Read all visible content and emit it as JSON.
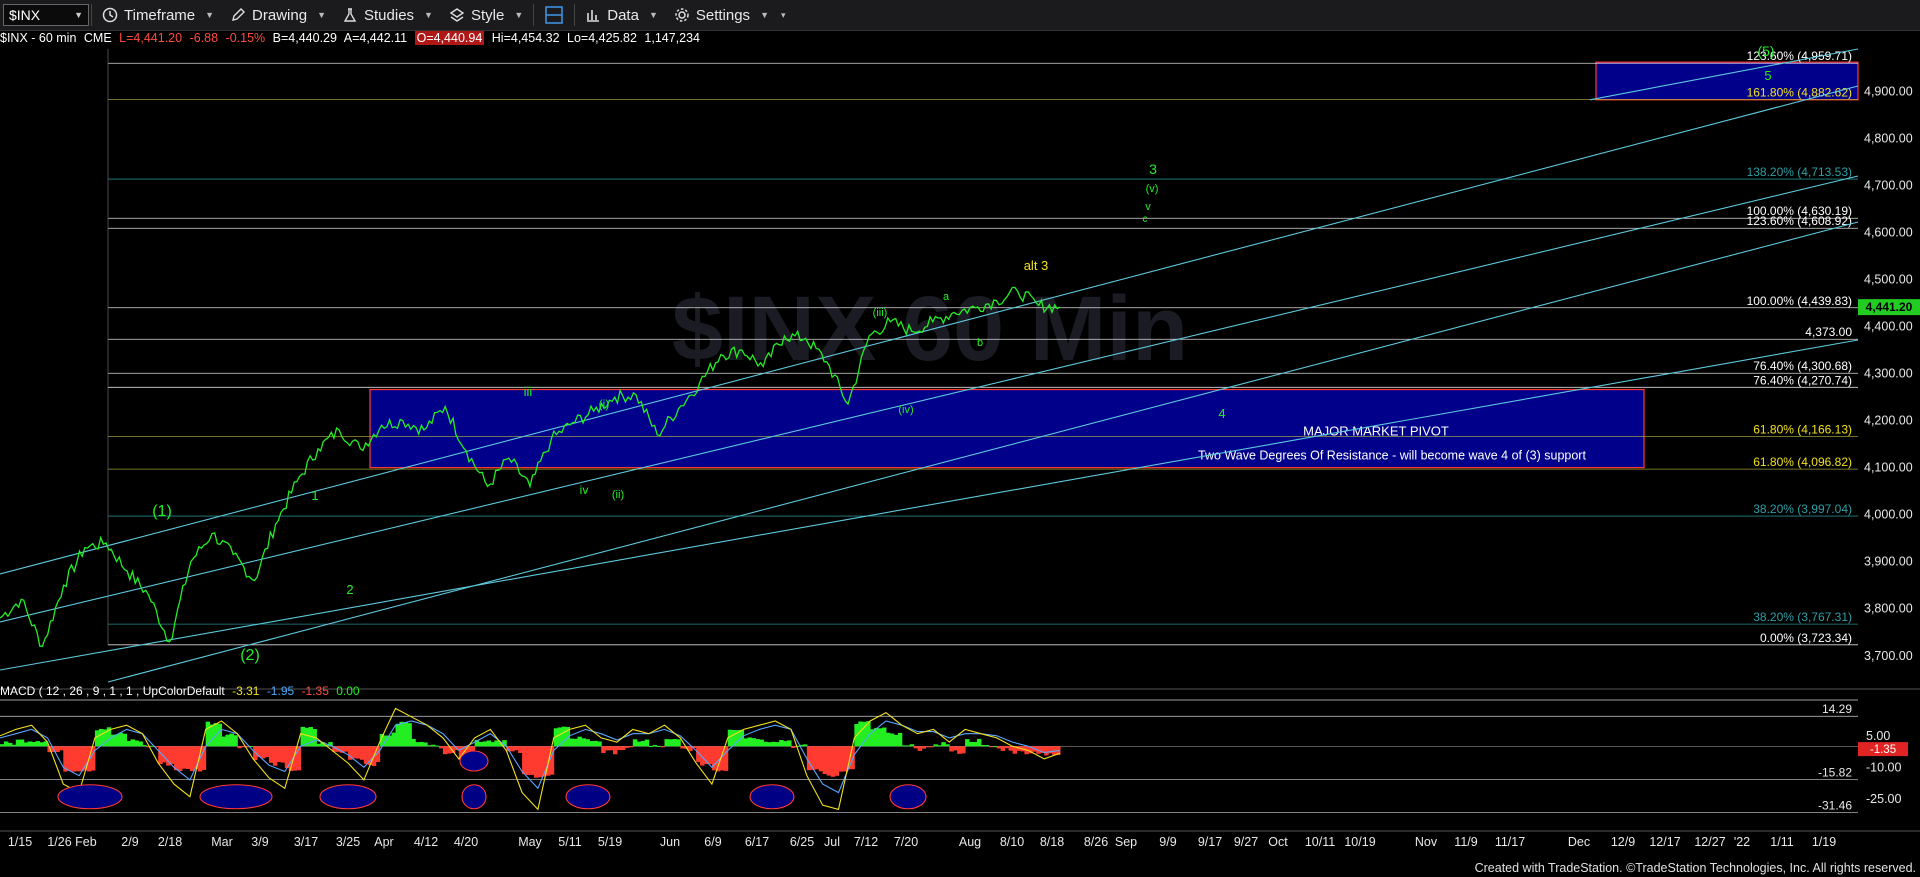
{
  "toolbar": {
    "symbol": "$INX",
    "items": [
      {
        "label": "Timeframe",
        "icon": "clock-icon"
      },
      {
        "label": "Drawing",
        "icon": "pencil-icon"
      },
      {
        "label": "Studies",
        "icon": "flask-icon"
      },
      {
        "label": "Style",
        "icon": "brush-icon"
      },
      {
        "label": "Data",
        "icon": "bars-icon"
      },
      {
        "label": "Settings",
        "icon": "gear-icon"
      }
    ]
  },
  "infobar": {
    "symbol": "$INX - 60 min",
    "exchange": "CME",
    "last": "L=4,441.20",
    "change": "-6.88",
    "change_pct": "-0.15%",
    "bid": "B=4,440.29",
    "ask": "A=4,442.11",
    "open": "O=4,440.94",
    "high": "Hi=4,454.32",
    "low": "Lo=4,425.82",
    "volume": "1,147,234"
  },
  "watermark": "$INX 60 Min",
  "colors": {
    "background": "#000000",
    "price": "#22ee22",
    "fib_lines": "#2d9fa6",
    "channel": "#6ec6d8",
    "zone": "#00008b",
    "zone_border": "#ff3b30",
    "negative": "#ff3b30",
    "positive": "#22ee22",
    "label_yellow": "#f2e11e"
  },
  "chart_data": [
    {
      "type": "line",
      "series": [
        {
          "x": [
            "1/15",
            "1/20",
            "1/26",
            "2/3",
            "2/9",
            "2/18",
            "2/26",
            "3/4",
            "3/9",
            "3/12",
            "3/17",
            "3/23",
            "3/25",
            "4/1",
            "4/5",
            "4/12",
            "4/16",
            "4/20",
            "4/26",
            "4/29",
            "5/4",
            "5/7",
            "5/10",
            "5/12",
            "5/14",
            "5/19",
            "5/21",
            "5/27",
            "6/4",
            "6/10",
            "6/15",
            "6/18",
            "6/21",
            "6/25",
            "7/1",
            "7/7",
            "7/8",
            "7/12",
            "7/15",
            "7/19",
            "7/20",
            "7/23",
            "7/26",
            "7/30",
            "8/4",
            "8/6",
            "8/10",
            "8/13",
            "8/16",
            "8/17",
            "8/18"
          ],
          "values": [
            3780,
            3820,
            3720,
            3850,
            3930,
            3940,
            3880,
            3830,
            3730,
            3900,
            3960,
            3915,
            3860,
            3980,
            4070,
            4140,
            4180,
            4140,
            4190,
            4200,
            4180,
            4230,
            4135,
            4060,
            4120,
            4060,
            4160,
            4195,
            4220,
            4250,
            4255,
            4170,
            4225,
            4280,
            4340,
            4350,
            4315,
            4380,
            4375,
            4325,
            4235,
            4380,
            4410,
            4390,
            4410,
            4430,
            4440,
            4455,
            4475,
            4445,
            4441.2
          ]
        }
      ],
      "ylim": [
        3640,
        4990
      ],
      "yticks": [
        "4,900.00",
        "4,800.00",
        "4,700.00",
        "4,600.00",
        "4,500.00",
        "4,400.00",
        "4,300.00",
        "4,200.00",
        "4,100.00",
        "4,000.00",
        "3,900.00",
        "3,800.00",
        "3,700.00"
      ],
      "xticks": [
        "1/15",
        "1/26 Feb",
        "2/9",
        "2/18",
        "Mar",
        "3/9",
        "3/17",
        "3/25",
        "Apr",
        "4/12",
        "4/20",
        "May",
        "5/11",
        "5/19",
        "Jun",
        "6/9",
        "6/17",
        "6/25",
        "Jul",
        "7/12",
        "7/20",
        "Aug",
        "8/10",
        "8/18",
        "8/26",
        "Sep",
        "9/9",
        "9/17",
        "9/27",
        "Oct",
        "10/11",
        "10/19",
        "Nov",
        "11/9",
        "11/17",
        "Dec",
        "12/9",
        "12/17",
        "12/27",
        "'22",
        "1/11",
        "1/19"
      ],
      "last_price_label": "4,441.20",
      "fib_levels": [
        {
          "label": "123.60% (4,959.71)",
          "value": 4959.71
        },
        {
          "label": "161.80% (4,882.62)",
          "value": 4882.62
        },
        {
          "label": "138.20% (4,713.53)",
          "value": 4713.53
        },
        {
          "label": "100.00% (4,630.19)",
          "value": 4630.19
        },
        {
          "label": "123.60% (4,608.92)",
          "value": 4608.92
        },
        {
          "label": "100.00% (4,439.83)",
          "value": 4439.83
        },
        {
          "label": "4,373.00",
          "value": 4373.0
        },
        {
          "label": "76.40% (4,300.68)",
          "value": 4300.68
        },
        {
          "label": "76.40% (4,270.74)",
          "value": 4270.74
        },
        {
          "label": "61.80% (4,166.13)",
          "value": 4166.13
        },
        {
          "label": "61.80% (4,096.82)",
          "value": 4096.82
        },
        {
          "label": "38.20% (3,997.04)",
          "value": 3997.04
        },
        {
          "label": "38.20% (3,767.31)",
          "value": 3767.31
        },
        {
          "label": "0.00% (3,723.34)",
          "value": 3723.34
        }
      ],
      "pivot_zone": {
        "top": 4266,
        "bottom": 4100,
        "title": "MAJOR MARKET PIVOT",
        "note": "Two Wave Degrees Of Resistance - will become wave 4 of (3) support"
      },
      "target_zone": {
        "top": 4962,
        "bottom": 4882
      },
      "wave_labels": [
        {
          "text": "(1)",
          "color": "green"
        },
        {
          "text": "(2)",
          "color": "green"
        },
        {
          "text": "1",
          "color": "green"
        },
        {
          "text": "2",
          "color": "green"
        },
        {
          "text": "iii",
          "color": "green"
        },
        {
          "text": "iv",
          "color": "green"
        },
        {
          "text": "(i)",
          "color": "green"
        },
        {
          "text": "(ii)",
          "color": "green"
        },
        {
          "text": "(iii)",
          "color": "green"
        },
        {
          "text": "(iv)",
          "color": "green"
        },
        {
          "text": "a",
          "color": "green"
        },
        {
          "text": "b",
          "color": "green"
        },
        {
          "text": "alt 3",
          "color": "yellow"
        },
        {
          "text": "3",
          "color": "green"
        },
        {
          "text": "(v)",
          "color": "green"
        },
        {
          "text": "v",
          "color": "green"
        },
        {
          "text": "c",
          "color": "green"
        },
        {
          "text": "4",
          "color": "green"
        },
        {
          "text": "5",
          "color": "green"
        },
        {
          "text": "(5)",
          "color": "green"
        }
      ]
    },
    {
      "type": "bar",
      "title": "MACD ( 12 , 26 , 9 , 1 , 1 , UpColorDefault",
      "readout": [
        "-3.31",
        "-1.95",
        "-1.35",
        "0.00"
      ],
      "ylim": [
        -36,
        22
      ],
      "yticks": [
        "5.00",
        "-10.00",
        "-25.00"
      ],
      "levels": [
        "14.29",
        "-15.82",
        "-31.46"
      ],
      "current_label": "-1.35",
      "macd": [
        5,
        8,
        10,
        2,
        -18,
        -22,
        4,
        8,
        10,
        6,
        -8,
        -18,
        -24,
        8,
        12,
        6,
        -6,
        -15,
        -20,
        6,
        4,
        -2,
        -8,
        -16,
        2,
        18,
        14,
        10,
        4,
        -6,
        4,
        8,
        -2,
        -22,
        -30,
        4,
        8,
        10,
        4,
        2,
        8,
        6,
        10,
        4,
        -8,
        -18,
        4,
        8,
        10,
        12,
        8,
        -14,
        -28,
        -30,
        4,
        12,
        16,
        10,
        6,
        8,
        2,
        8,
        6,
        4,
        0,
        -2,
        -6,
        -3.31
      ],
      "signal": [
        4,
        6,
        8,
        4,
        -10,
        -14,
        -2,
        4,
        8,
        6,
        -2,
        -10,
        -16,
        0,
        8,
        6,
        -2,
        -9,
        -12,
        0,
        3,
        0,
        -4,
        -10,
        -2,
        10,
        12,
        10,
        6,
        -2,
        2,
        6,
        0,
        -12,
        -20,
        -2,
        5,
        8,
        6,
        3,
        6,
        6,
        8,
        5,
        -2,
        -10,
        -2,
        5,
        8,
        10,
        8,
        -6,
        -18,
        -22,
        -4,
        6,
        12,
        10,
        7,
        7,
        4,
        6,
        6,
        5,
        2,
        0,
        -3,
        -1.95
      ],
      "ellipses": [
        "1/26 Feb",
        "3/9",
        "3/25",
        "4/20",
        "5/11",
        "6/17",
        "7/20"
      ]
    }
  ],
  "footer": "Created with TradeStation. ©TradeStation Technologies, Inc. All rights reserved."
}
